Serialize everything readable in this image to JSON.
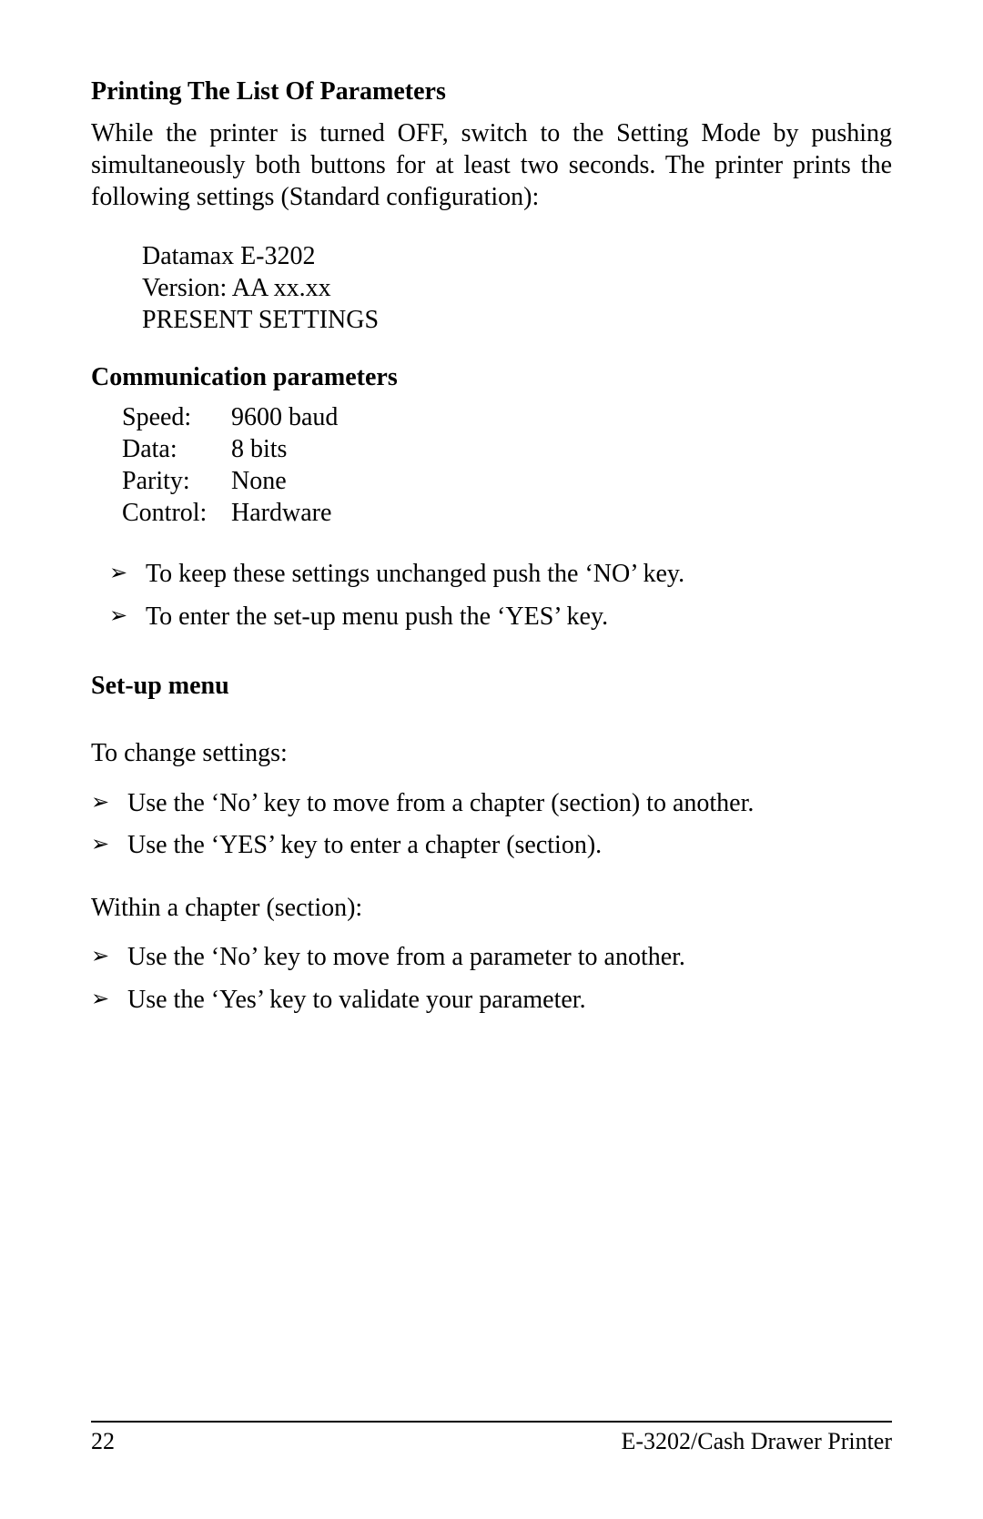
{
  "section1": {
    "heading": "Printing The List Of Parameters",
    "intro": "While the printer is turned OFF, switch to the Setting Mode by pushing simultaneously both buttons for at least two seconds. The printer prints the following settings (Standard configuration):",
    "settings_lines": {
      "line1": "Datamax E-3202",
      "line2": "Version: AA xx.xx",
      "line3": "PRESENT SETTINGS"
    }
  },
  "section2": {
    "heading": "Communication parameters",
    "params": {
      "row0": {
        "label": "Speed:",
        "value": "9600 baud"
      },
      "row1": {
        "label": "Data:",
        "value": "8 bits"
      },
      "row2": {
        "label": "Parity:",
        "value": "None"
      },
      "row3": {
        "label": "Control:",
        "value": "Hardware"
      }
    },
    "bullets": {
      "b0": "To keep these settings unchanged push the ‘NO’ key.",
      "b1": "To enter the set-up menu push the ‘YES’ key."
    }
  },
  "section3": {
    "heading": "Set-up menu",
    "intro": "To change settings:",
    "bullets1": {
      "b0": "Use the ‘No’ key to move from a chapter (section) to another.",
      "b1": "Use the ‘YES’ key to enter a chapter (section)."
    },
    "within": "Within a chapter (section):",
    "bullets2": {
      "b0": "Use the ‘No’ key to move from a parameter to another.",
      "b1": "Use the ‘Yes’ key to validate your parameter."
    }
  },
  "footer": {
    "page": "22",
    "title": "E-3202/Cash Drawer Printer"
  },
  "arrow_glyph": "➢"
}
